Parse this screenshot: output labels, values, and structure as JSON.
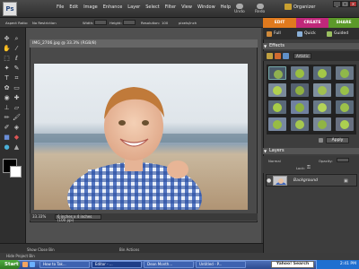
{
  "menu": {
    "logo": "Ps",
    "items": [
      "File",
      "Edit",
      "Image",
      "Enhance",
      "Layer",
      "Select",
      "Filter",
      "View",
      "Window",
      "Help"
    ],
    "undo": "Undo",
    "redo": "Redo",
    "organizer": "Organizer"
  },
  "window_controls": [
    "_",
    "□",
    "x"
  ],
  "options_bar": {
    "aspect_ratio_label": "Aspect Ratio:",
    "aspect_ratio_value": "No Restriction",
    "width_label": "Width:",
    "height_label": "Height:",
    "resolution_label": "Resolution:",
    "resolution_value": "100",
    "resolution_unit": "pixels/inch"
  },
  "mode_tabs": [
    {
      "label": "EDIT",
      "color": "#e07a1e"
    },
    {
      "label": "CREATE",
      "color": "#c0287a"
    },
    {
      "label": "SHARE",
      "color": "#5c9a2a"
    }
  ],
  "sub_tabs": [
    "Full",
    "Quick",
    "Guided"
  ],
  "document": {
    "title": "IMG_2706.jpg @ 33.3% (RGB/8)",
    "zoom": "33.33%",
    "info": "6 inches x 4 inches (100 ppi)"
  },
  "bottom_strip": {
    "show_bin": "Show Close Bin",
    "bin_actions": "Bin Actions",
    "hide_project_bin": "Hide Project Bin"
  },
  "effects": {
    "title": "Effects",
    "category": "Artistic",
    "apply_label": "Apply"
  },
  "layers": {
    "title": "Layers",
    "normal": "Normal",
    "opacity": "Opacity:",
    "lock": "Lock:",
    "layer_name": "Background"
  },
  "taskbar": {
    "start": "Start",
    "tasks": [
      "How to Tak...",
      "Editor - ...",
      "Dean Month...",
      "Untitled - P..."
    ],
    "search": "Yahoo! Search",
    "time": "2:41 PM"
  },
  "colors": {
    "accent_orange": "#e07a1e",
    "accent_magenta": "#c0287a",
    "accent_green": "#5c9a2a",
    "taskbar_blue": "#2c4a8f"
  }
}
